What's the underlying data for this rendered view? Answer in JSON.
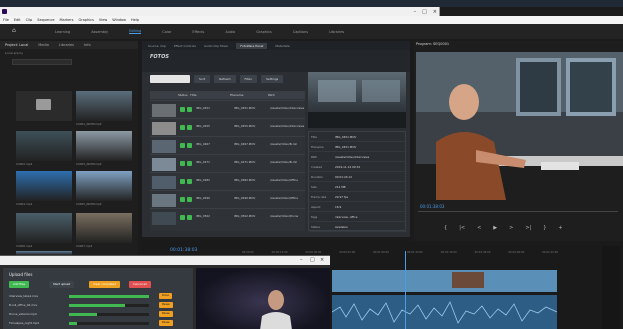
{
  "os_title": "11 | Location: https://... | Adobe Premiere Pro",
  "window": {
    "title": "Adobe Premiere Pro (Beta) - D:\\Project\\Local.prproj *",
    "menus": [
      "File",
      "Edit",
      "Clip",
      "Sequence",
      "Markers",
      "Graphics",
      "View",
      "Window",
      "Help"
    ]
  },
  "workspaces": {
    "items": [
      "Learning",
      "Assembly",
      "Editing",
      "Color",
      "Effects",
      "Audio",
      "Graphics",
      "Captions",
      "Libraries"
    ],
    "active_index": 2
  },
  "project_panel": {
    "tabs": [
      "Project: Local",
      "Media",
      "Libraries",
      "Info"
    ],
    "path": "Local.prproj",
    "clips": [
      "C0001_INCEP.mp4",
      "C0002.mp4",
      "C0003_INCEP.mp4",
      "C0004.mp4",
      "C0005_INCEP.mp4",
      "C0006.mp4",
      "C0007.mp4",
      "C0008.mp4"
    ]
  },
  "plugin_panel": {
    "tabs": [
      "Source: Clip",
      "Effect Controls",
      "Audio Clip Mixer",
      "FotoWare Panel",
      "Metadata"
    ],
    "active_tab": 3,
    "logo": "FOTOS",
    "search_placeholder": "",
    "toolbar": [
      "Sort",
      "Refresh",
      "Filter",
      "Settings"
    ],
    "columns": [
      "",
      "Status",
      "Title",
      "Filename",
      "Path"
    ],
    "rows": [
      {
        "title": "IMG_0451",
        "file": "IMG_0451.MOV",
        "path": "/Assets/Video/Interviews"
      },
      {
        "title": "IMG_0455",
        "file": "IMG_0455.MOV",
        "path": "/Assets/Video/Interviews"
      },
      {
        "title": "IMG_0467",
        "file": "IMG_0467.MOV",
        "path": "/Assets/Video/B-roll"
      },
      {
        "title": "IMG_0471",
        "file": "IMG_0471.MOV",
        "path": "/Assets/Video/B-roll"
      },
      {
        "title": "IMG_0482",
        "file": "IMG_0482.MOV",
        "path": "/Assets/Video/Office"
      },
      {
        "title": "IMG_0490",
        "file": "IMG_0490.MOV",
        "path": "/Assets/Video/Office"
      },
      {
        "title": "IMG_0502",
        "file": "IMG_0502.MOV",
        "path": "/Assets/Video/Drone"
      }
    ],
    "details": [
      {
        "k": "Title",
        "v": "IMG_0451.MOV"
      },
      {
        "k": "Filename",
        "v": "IMG_0451.MOV"
      },
      {
        "k": "Path",
        "v": "/Assets/Video/Interviews"
      },
      {
        "k": "Created",
        "v": "2019-11-14 09:32"
      },
      {
        "k": "Duration",
        "v": "00:01:24:12"
      },
      {
        "k": "Size",
        "v": "212 MB"
      },
      {
        "k": "Frame rate",
        "v": "29.97 fps"
      },
      {
        "k": "Aspect",
        "v": "16:9"
      },
      {
        "k": "Tags",
        "v": "interview, office"
      },
      {
        "k": "Status",
        "v": "Available"
      }
    ]
  },
  "program_monitor": {
    "tab": "Program: SEQ0001",
    "timecode": "00:01:38:03",
    "controls": [
      "{",
      "|<",
      "<",
      "▶",
      ">",
      ">|",
      "}",
      "+"
    ]
  },
  "timeline": {
    "timecode": "00:01:38:03",
    "ruler": [
      "00:00:00",
      "00:00:15:00",
      "00:00:30:00",
      "00:00:45:00",
      "00:01:00:00",
      "00:01:15:00",
      "00:01:30:00",
      "00:01:45:00",
      "00:02:00:00",
      "00:02:15:00"
    ]
  },
  "upload_window": {
    "title": "Upload files",
    "buttons": [
      {
        "label": "Add files",
        "color": "#3fb950"
      },
      {
        "label": "Start upload",
        "color": "#3c4249"
      },
      {
        "label": "Clear completed",
        "color": "#f0a020"
      },
      {
        "label": "Cancel all",
        "color": "#e05050"
      }
    ],
    "files": [
      {
        "name": "Interview_take1.mov",
        "progress": 1.0,
        "action": "Done"
      },
      {
        "name": "B-roll_office_02.mov",
        "progress": 0.7,
        "action": "Pause"
      },
      {
        "name": "Drone_exterior.mp4",
        "progress": 0.35,
        "action": "Pause"
      },
      {
        "name": "Timelapse_night.mp4",
        "progress": 0.1,
        "action": "Pause"
      }
    ]
  },
  "colors": {
    "accent": "#4c9be8",
    "ok": "#3fb950",
    "warn": "#f0a020",
    "danger": "#e05050"
  }
}
